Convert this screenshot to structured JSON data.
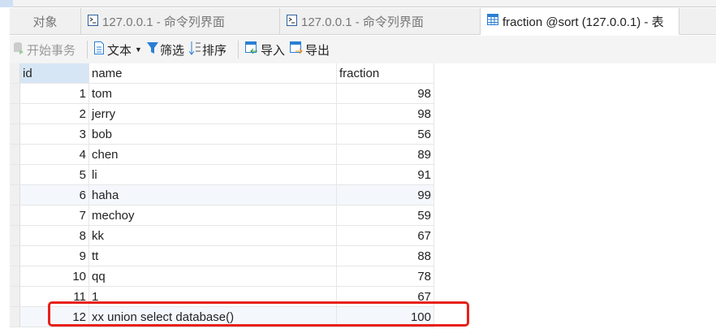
{
  "tabs": [
    {
      "label": "对象",
      "icon": "none"
    },
    {
      "label": "127.0.0.1 - 命令列界面",
      "icon": "console-icon"
    },
    {
      "label": "127.0.0.1 - 命令列界面",
      "icon": "console-icon"
    },
    {
      "label": "fraction @sort (127.0.0.1) - 表",
      "icon": "table-icon",
      "active": true
    }
  ],
  "toolbar": {
    "begin_transaction": "开始事务",
    "text": "文本",
    "filter": "筛选",
    "sort": "排序",
    "import": "导入",
    "export": "导出"
  },
  "columns": [
    "id",
    "name",
    "fraction"
  ],
  "rows": [
    {
      "id": "1",
      "name": "tom",
      "fraction": "98"
    },
    {
      "id": "2",
      "name": "jerry",
      "fraction": "98"
    },
    {
      "id": "3",
      "name": "bob",
      "fraction": "56"
    },
    {
      "id": "4",
      "name": "chen",
      "fraction": "89"
    },
    {
      "id": "5",
      "name": "li",
      "fraction": "91"
    },
    {
      "id": "6",
      "name": "haha",
      "fraction": "99"
    },
    {
      "id": "7",
      "name": "mechoy",
      "fraction": "59"
    },
    {
      "id": "8",
      "name": "kk",
      "fraction": "67"
    },
    {
      "id": "9",
      "name": "tt",
      "fraction": "88"
    },
    {
      "id": "10",
      "name": "qq",
      "fraction": "78"
    },
    {
      "id": "11",
      "name": "1",
      "fraction": "67"
    },
    {
      "id": "12",
      "name": "xx union select database()",
      "fraction": "100"
    }
  ],
  "colors": {
    "highlight": "#e8201a",
    "accent": "#2a7fd4"
  }
}
